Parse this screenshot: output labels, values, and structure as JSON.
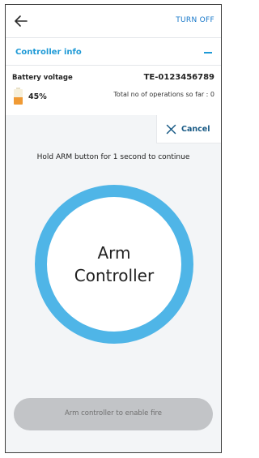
{
  "header": {
    "back_icon": "arrow-left-icon",
    "turn_off_label": "TURN OFF"
  },
  "controller_info": {
    "title": "Controller info",
    "collapse_icon": "minus-icon",
    "battery_label": "Battery voltage",
    "battery_level_fraction": 0.45,
    "battery_percent": "45%",
    "battery_icon": "battery-icon",
    "serial_number": "TE-0123456789",
    "operations_text": "Total no of operations so far : 0"
  },
  "arming": {
    "cancel_label": "Cancel",
    "cancel_icon": "close-icon",
    "instruction": "Hold ARM button for 1 second to continue",
    "arm_button_label_line1": "Arm",
    "arm_button_label_line2": "Controller",
    "fire_button_label": "Arm controller to enable fire"
  },
  "colors": {
    "accent": "#1f9ad6",
    "ring": "#4fb5e7",
    "battery_fill": "#f09a34",
    "disabled_button": "#c2c4c7",
    "cancel_text": "#1a5b86"
  }
}
